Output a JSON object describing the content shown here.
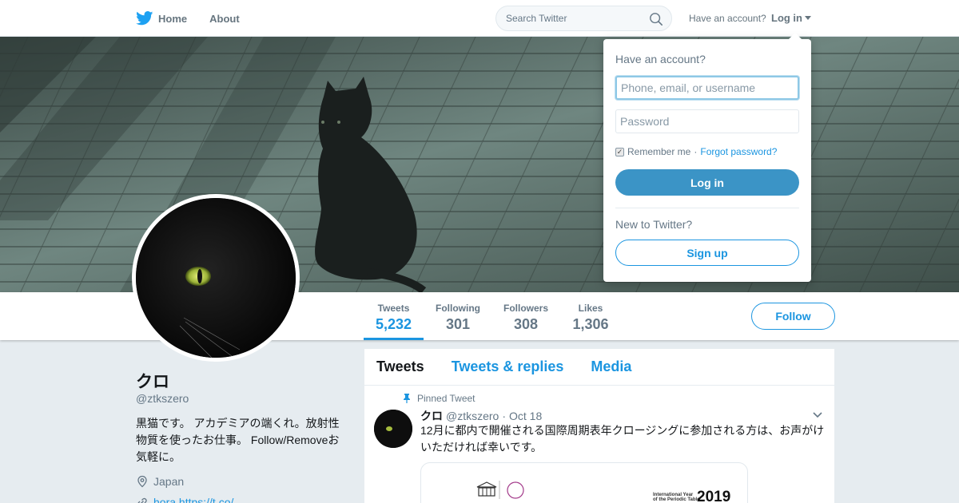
{
  "topnav": {
    "home_label": "Home",
    "about_label": "About",
    "search_placeholder": "Search Twitter",
    "have_account": "Have an account?",
    "login_label": "Log in"
  },
  "profile": {
    "name": "クロ",
    "handle": "@ztkszero",
    "bio": "黒猫です。 アカデミアの端くれ。放射性物質を使ったお仕事。 Follow/Removeお気軽に。",
    "location": "Japan",
    "link": "hora.https://t.co/..."
  },
  "stats": [
    {
      "label": "Tweets",
      "value": "5,232",
      "active": true
    },
    {
      "label": "Following",
      "value": "301",
      "active": false
    },
    {
      "label": "Followers",
      "value": "308",
      "active": false
    },
    {
      "label": "Likes",
      "value": "1,306",
      "active": false
    }
  ],
  "follow_label": "Follow",
  "timeline": {
    "tabs": [
      "Tweets",
      "Tweets & replies",
      "Media"
    ],
    "pinned_label": "Pinned Tweet",
    "tweet": {
      "author": "クロ",
      "handle": "@ztkszero",
      "separator": "·",
      "date": "Oct 18",
      "text": "12月に都内で開催される国際周期表年クロージングに参加される方は、お声がけいただければ幸いです。",
      "card_line1": "International Year",
      "card_line2": "of the Periodic Table",
      "card_year": "2019"
    }
  },
  "login_dropdown": {
    "title": "Have an account?",
    "username_placeholder": "Phone, email, or username",
    "password_placeholder": "Password",
    "remember_label": "Remember me",
    "separator": "·",
    "forgot_label": "Forgot password?",
    "login_button": "Log in",
    "new_label": "New to Twitter?",
    "signup_button": "Sign up"
  },
  "colors": {
    "accent": "#1b95e0",
    "login_button": "#3b94c6",
    "background": "#e6ecf0"
  }
}
